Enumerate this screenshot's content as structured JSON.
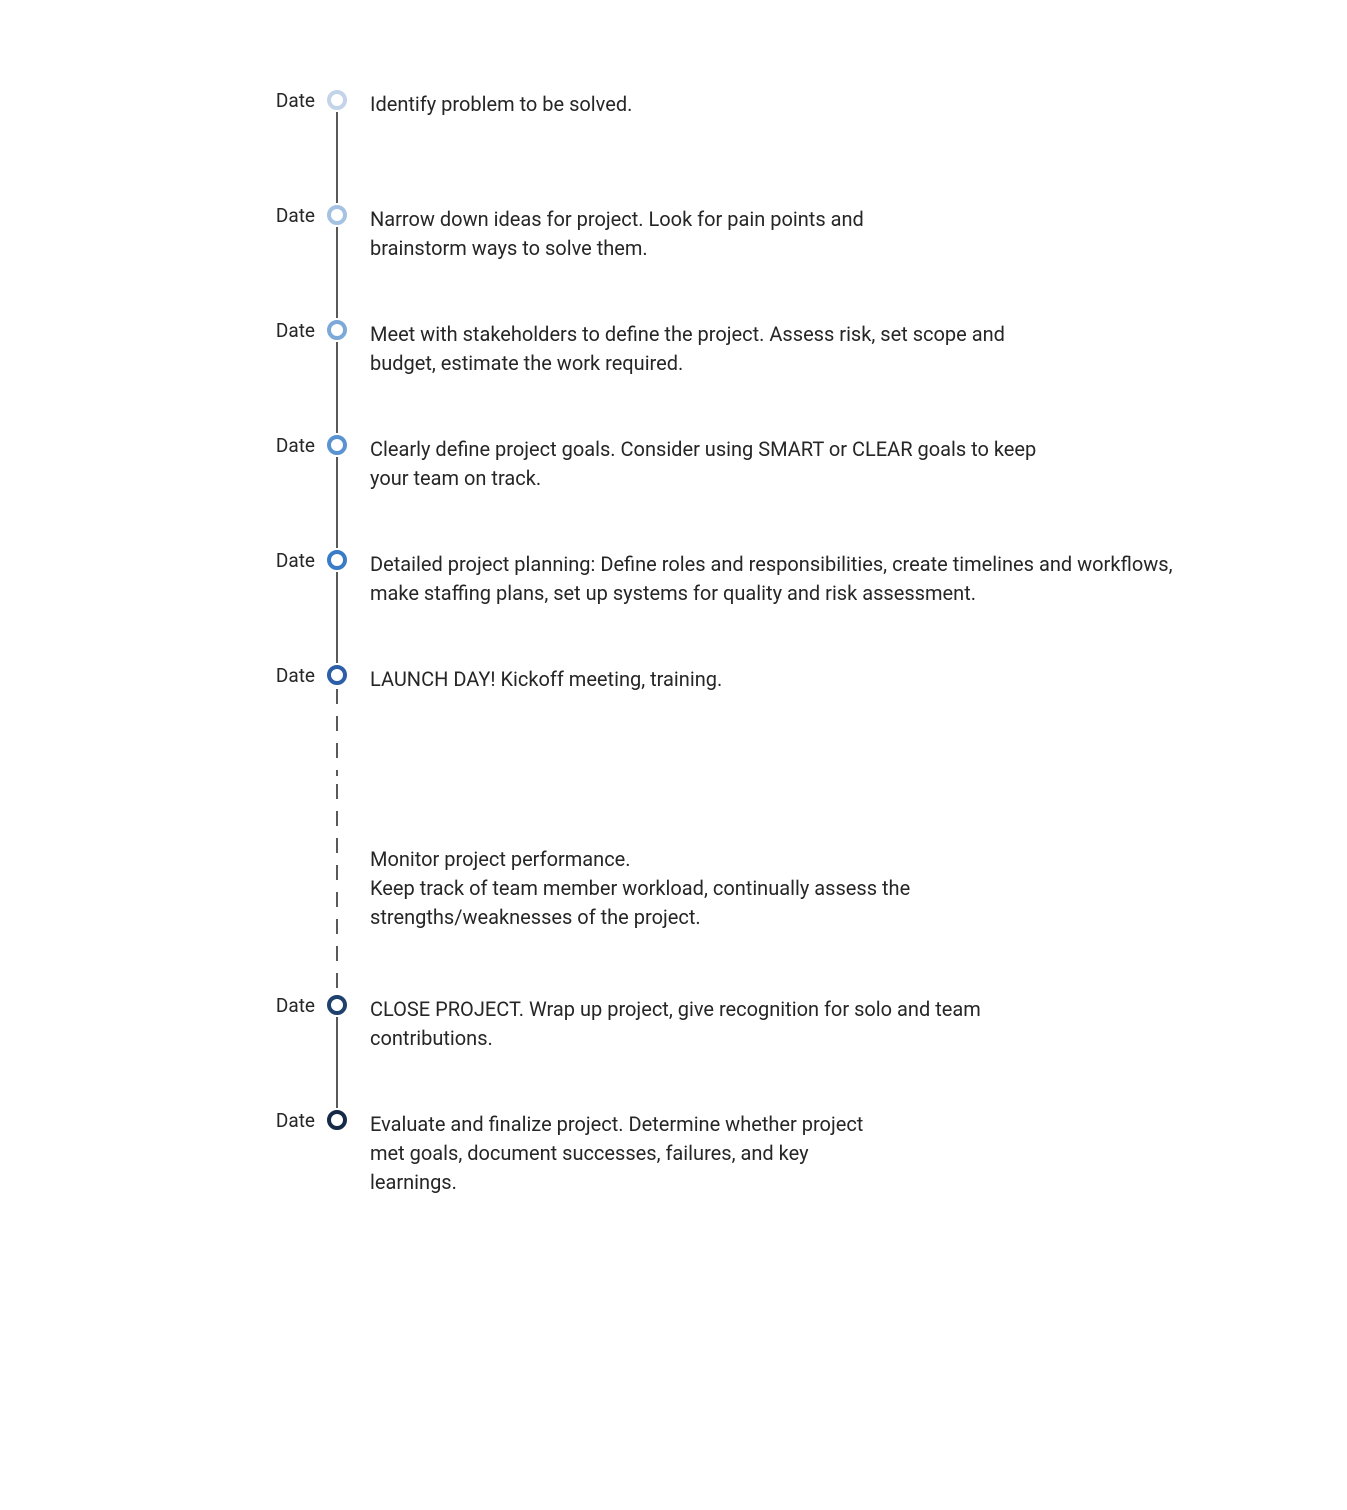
{
  "timeline": {
    "date_label": "Date",
    "items": [
      {
        "text": "Identify problem to be solved.",
        "has_date": true,
        "circle_class": "c1",
        "line_style": "solid",
        "width_class": "w-narrow"
      },
      {
        "text": "Narrow down ideas for project. Look for pain points and brainstorm ways to solve them.",
        "has_date": true,
        "circle_class": "c2",
        "line_style": "solid",
        "width_class": "w-narrow"
      },
      {
        "text": "Meet with stakeholders to define the project. Assess risk, set scope and budget, estimate the work required.",
        "has_date": true,
        "circle_class": "c3",
        "line_style": "solid",
        "width_class": "w-med"
      },
      {
        "text": "Clearly define project goals. Consider using SMART or CLEAR goals to keep your team on track.",
        "has_date": true,
        "circle_class": "c4",
        "line_style": "solid",
        "width_class": "w-med"
      },
      {
        "text": "Detailed project planning: Define roles and responsibilities, create timelines and workflows, make staffing plans, set up systems for quality and risk assessment.",
        "has_date": true,
        "circle_class": "c5",
        "line_style": "solid",
        "width_class": "w-wide"
      },
      {
        "text": "LAUNCH DAY! Kickoff meeting, training.",
        "has_date": true,
        "circle_class": "c6",
        "line_style": "dashed",
        "width_class": "w-narrow"
      },
      {
        "text": "Monitor project performance.\nKeep track of team member workload, continually assess the strengths/weaknesses of the project.",
        "has_date": false,
        "circle_class": "",
        "line_style": "dashed",
        "width_class": "w-narrow"
      },
      {
        "text": "CLOSE PROJECT. Wrap up project, give recognition for solo and team contributions.",
        "has_date": true,
        "circle_class": "c7",
        "line_style": "solid",
        "width_class": "w-med"
      },
      {
        "text": "Evaluate and finalize project. Determine whether project met goals, document successes, failures, and key learnings.",
        "has_date": true,
        "circle_class": "c8",
        "line_style": "none",
        "width_class": "w-mid"
      }
    ]
  }
}
